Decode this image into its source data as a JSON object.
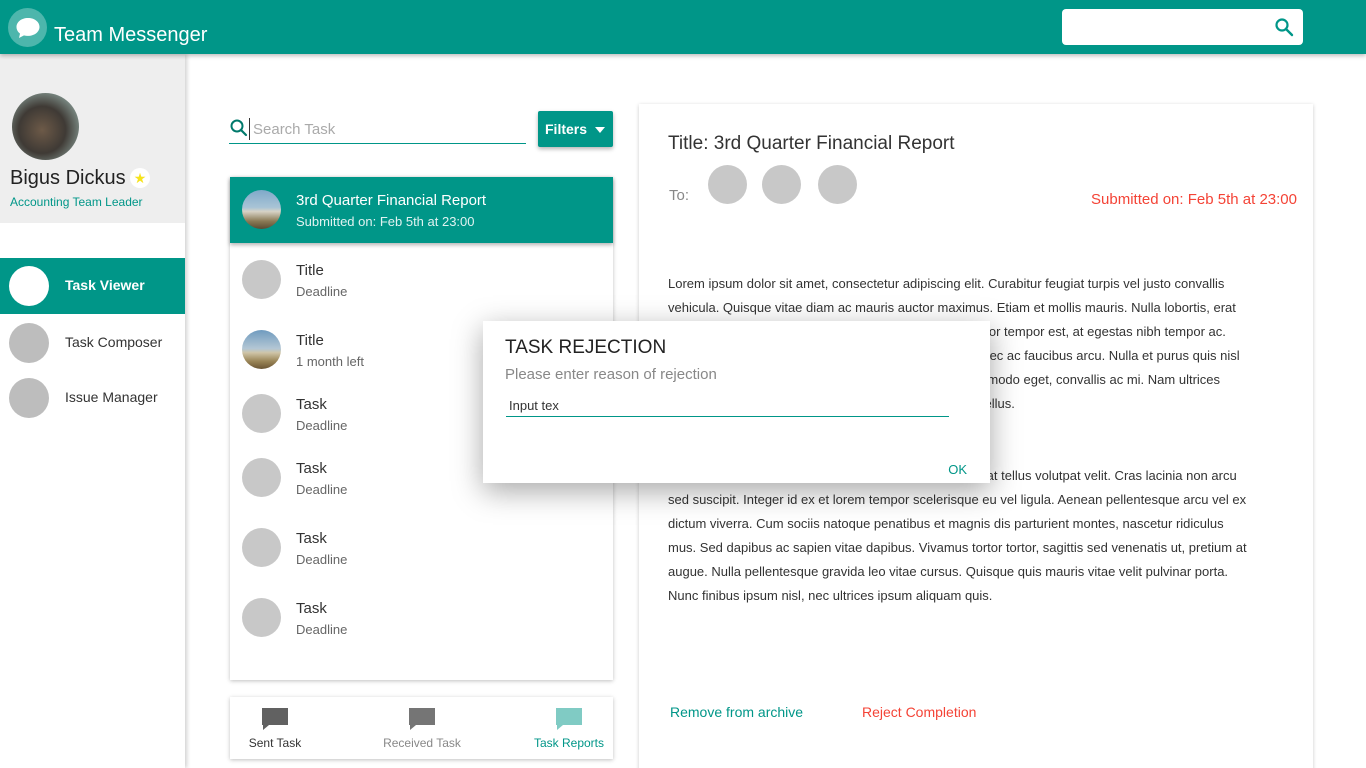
{
  "app": {
    "title": "Team Messenger"
  },
  "top_search": {
    "placeholder": ""
  },
  "user": {
    "name": "Bigus Dickus",
    "role": "Accounting Team Leader",
    "badge_icon": "star-icon"
  },
  "nav": [
    {
      "label": "Task Viewer",
      "active": true
    },
    {
      "label": "Task Composer",
      "active": false
    },
    {
      "label": "Issue Manager",
      "active": false
    }
  ],
  "task_search": {
    "placeholder": "Search Task"
  },
  "filters": {
    "label": "Filters"
  },
  "tasks": [
    {
      "title": "3rd Quarter Financial Report",
      "sub": "Submitted on: Feb 5th at 23:00",
      "selected": true
    },
    {
      "title": "Title",
      "sub": "Deadline"
    },
    {
      "title": "Title",
      "sub": "1 month left"
    },
    {
      "title": "Task",
      "sub": "Deadline"
    },
    {
      "title": "Task",
      "sub": "Deadline"
    },
    {
      "title": "Task",
      "sub": "Deadline"
    },
    {
      "title": "Task",
      "sub": "Deadline"
    }
  ],
  "tabs": [
    {
      "label": "Sent Task"
    },
    {
      "label": "Received Task"
    },
    {
      "label": "Task Reports"
    }
  ],
  "detail": {
    "title": "Title: 3rd Quarter Financial Report",
    "to_label": "To:",
    "submitted": "Submitted on: Feb 5th at 23:00",
    "para1": "Lorem ipsum dolor sit amet, consectetur adipiscing elit. Curabitur feugiat turpis vel justo convallis vehicula. Quisque vitae diam ac mauris auctor maximus. Etiam et mollis mauris. Nulla lobortis, erat eu finibus pellentesque, odio dui tristique sed. Duis auctor tempor est, at egestas nibh tempor ac. Suspendisse potenti. Praesent dui sed, porttitor ex. Donec ac faucibus arcu. Nulla et purus quis nisl interdum, sollicitudin a elit sapien, scelerisque quis commodo eget, convallis ac mi. Nam ultrices lorem a sapien, purus dignissim euismod eleifend nec tellus.",
    "para2": "Nullam tincidunt eros nec diam malesuada, vitae placerat tellus volutpat velit. Cras lacinia non arcu sed suscipit. Integer id ex et lorem tempor scelerisque eu vel ligula. Aenean pellentesque arcu vel ex dictum viverra. Cum sociis natoque penatibus et magnis dis parturient montes, nascetur ridiculus mus. Sed dapibus ac sapien vitae dapibus. Vivamus tortor tortor, sagittis sed venenatis ut, pretium at augue. Nulla pellentesque gravida leo vitae cursus. Quisque quis mauris vitae velit pulvinar porta. Nunc finibus ipsum nisl, nec ultrices ipsum aliquam quis.",
    "remove_label": "Remove from archive",
    "reject_label": "Reject Completion"
  },
  "modal": {
    "title": "TASK REJECTION",
    "subtitle": "Please enter reason of rejection",
    "input_value": "Input tex",
    "ok_label": "OK"
  },
  "colors": {
    "primary": "#009688",
    "primary_light": "#80cbc4",
    "danger": "#f44336",
    "star": "#f6e31b"
  }
}
